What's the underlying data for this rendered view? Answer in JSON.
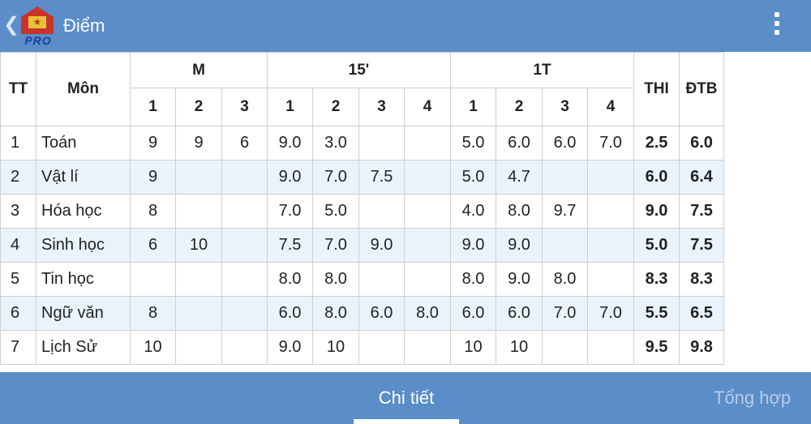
{
  "appbar": {
    "back_glyph": "❮",
    "logo_text": "PRO",
    "logo_star": "★",
    "title": "Điểm",
    "menu_icon": "overflow-menu-icon"
  },
  "table": {
    "headers": {
      "tt": "TT",
      "mon": "Môn",
      "m": "M",
      "p15": "15'",
      "t1": "1T",
      "thi": "THI",
      "dtb": "ĐTB"
    },
    "sub": {
      "m": [
        "1",
        "2",
        "3"
      ],
      "p15": [
        "1",
        "2",
        "3",
        "4"
      ],
      "t1": [
        "1",
        "2",
        "3",
        "4"
      ]
    },
    "rows": [
      {
        "tt": "1",
        "mon": "Toán",
        "m": [
          "9",
          "9",
          "6"
        ],
        "p15": [
          "9.0",
          "3.0",
          "",
          ""
        ],
        "t1": [
          "5.0",
          "6.0",
          "6.0",
          "7.0"
        ],
        "thi": "2.5",
        "dtb": "6.0"
      },
      {
        "tt": "2",
        "mon": "Vật lí",
        "m": [
          "9",
          "",
          ""
        ],
        "p15": [
          "9.0",
          "7.0",
          "7.5",
          ""
        ],
        "t1": [
          "5.0",
          "4.7",
          "",
          ""
        ],
        "thi": "6.0",
        "dtb": "6.4"
      },
      {
        "tt": "3",
        "mon": "Hóa học",
        "m": [
          "8",
          "",
          ""
        ],
        "p15": [
          "7.0",
          "5.0",
          "",
          ""
        ],
        "t1": [
          "4.0",
          "8.0",
          "9.7",
          ""
        ],
        "thi": "9.0",
        "dtb": "7.5"
      },
      {
        "tt": "4",
        "mon": "Sinh học",
        "m": [
          "6",
          "10",
          ""
        ],
        "p15": [
          "7.5",
          "7.0",
          "9.0",
          ""
        ],
        "t1": [
          "9.0",
          "9.0",
          "",
          ""
        ],
        "thi": "5.0",
        "dtb": "7.5"
      },
      {
        "tt": "5",
        "mon": "Tin học",
        "m": [
          "",
          "",
          ""
        ],
        "p15": [
          "8.0",
          "8.0",
          "",
          ""
        ],
        "t1": [
          "8.0",
          "9.0",
          "8.0",
          ""
        ],
        "thi": "8.3",
        "dtb": "8.3"
      },
      {
        "tt": "6",
        "mon": "Ngữ văn",
        "m": [
          "8",
          "",
          ""
        ],
        "p15": [
          "6.0",
          "8.0",
          "6.0",
          "8.0"
        ],
        "t1": [
          "6.0",
          "6.0",
          "7.0",
          "7.0"
        ],
        "thi": "5.5",
        "dtb": "6.5"
      },
      {
        "tt": "7",
        "mon": "Lịch Sử",
        "m": [
          "10",
          "",
          ""
        ],
        "p15": [
          "9.0",
          "10",
          "",
          ""
        ],
        "t1": [
          "10",
          "10",
          "",
          ""
        ],
        "thi": "9.5",
        "dtb": "9.8"
      }
    ]
  },
  "tabs": {
    "detail": "Chi tiết",
    "summary": "Tổng hợp"
  },
  "colors": {
    "bar": "#5b8dc9",
    "row_alt": "#eaf3fb",
    "indicator": "#ffffff"
  }
}
